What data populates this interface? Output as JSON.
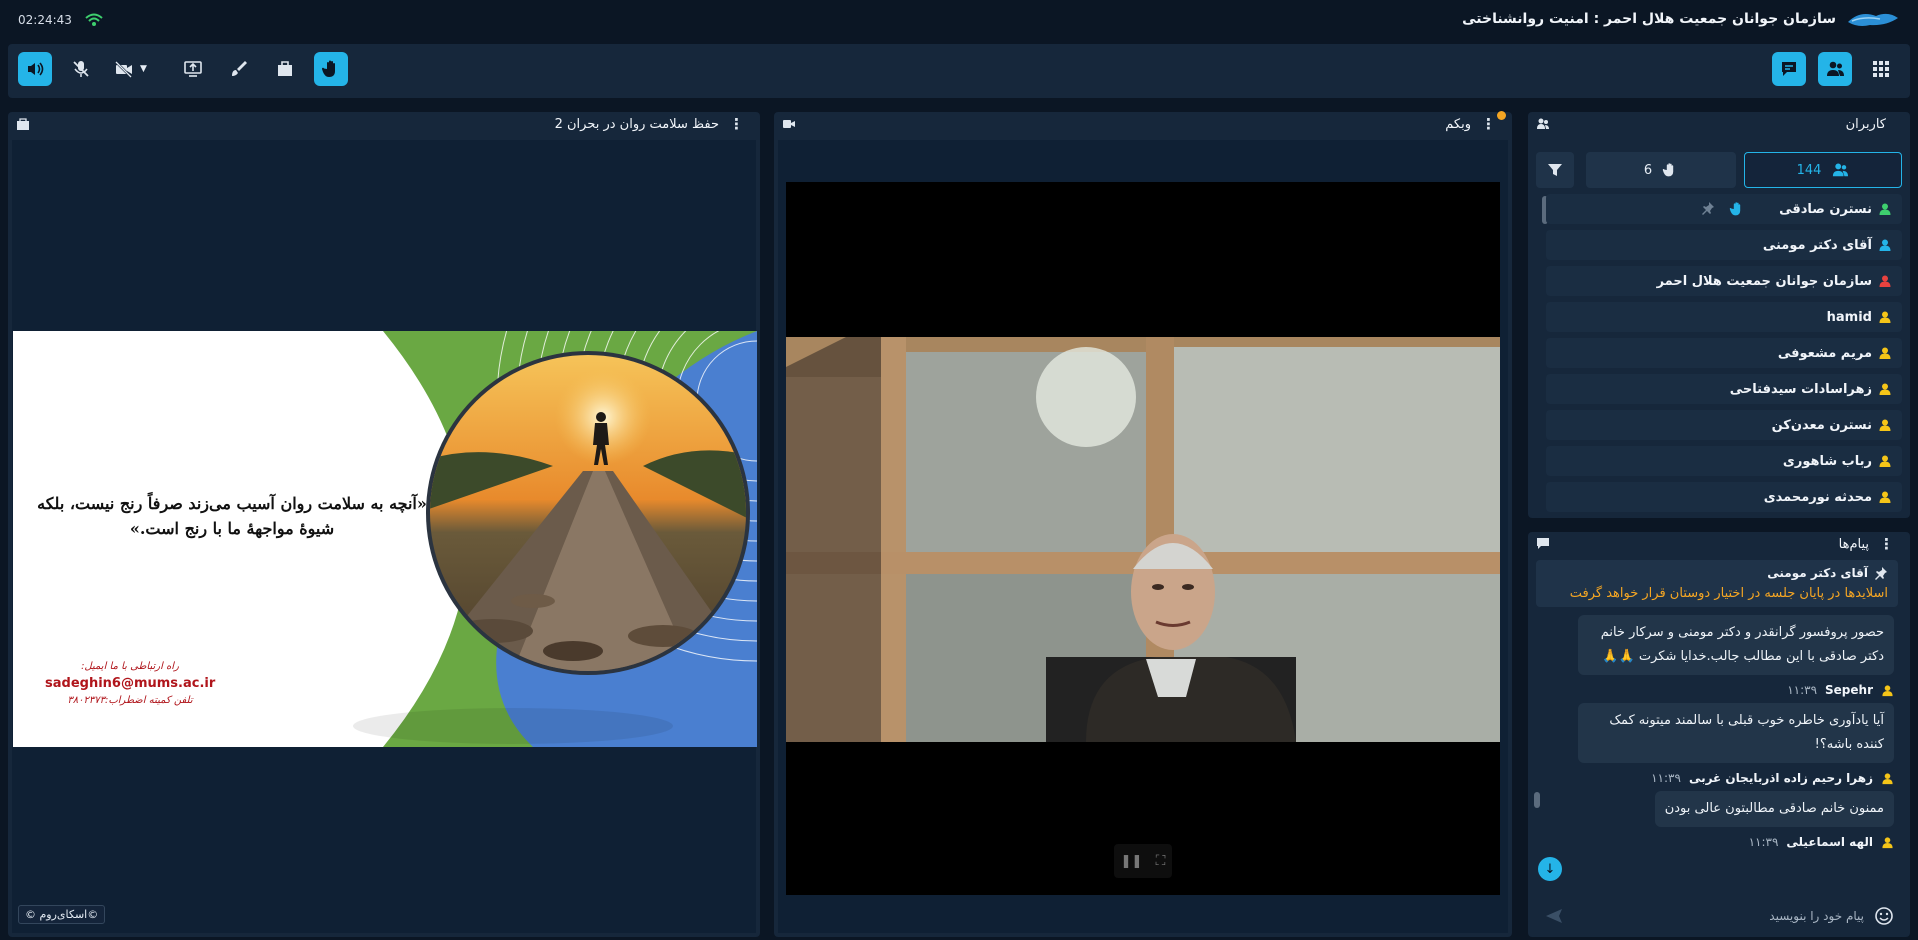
{
  "app": {
    "title": "سازمان جوانان جمعیت هلال احمر : امنیت روانشناختی",
    "clock": "02:24:43"
  },
  "toolbar": {
    "left_buttons": [
      "speaker-icon",
      "mic-muted-icon",
      "camera-off-icon",
      "screen-share-icon",
      "brush-icon",
      "file-icon",
      "raise-hand-icon"
    ],
    "right_buttons": [
      "chat-icon",
      "users-icon",
      "apps-grid-icon"
    ]
  },
  "colors": {
    "accent": "#24b4e8",
    "panel": "#16273b",
    "bg": "#0b1624",
    "pinned_text": "#f5a623"
  },
  "presentation": {
    "title": "حفظ سلامت روان در بحران 2",
    "quote": "«آنچه به سلامت روان آسیب می‌زند صرفاً رنج نیست، بلکه شیوهٔ مواجههٔ ما با رنج است.»",
    "contact_line1": "راه ارتباطی با ما ایمیل:",
    "contact_email": "sadeghin6@mums.ac.ir",
    "contact_line3": "تلفن کمیته اضطراب:۳۸۰۲۳۷۳",
    "watermark": "©اسکای‌روم ©"
  },
  "webcam": {
    "title": "وبکم"
  },
  "users": {
    "title": "کاربران",
    "tab_all_count": "144",
    "tab_hands_count": "6",
    "list": [
      {
        "name": "نسترن صادقی",
        "color": "#3ecf6e"
      },
      {
        "name": "آقای دکتر مومنی",
        "color": "#24b4e8"
      },
      {
        "name": "سازمان جوانان جمعیت هلال احمر",
        "color": "#e8423f"
      },
      {
        "name": "hamid",
        "color": "#f5c518"
      },
      {
        "name": "مریم مشعوفی",
        "color": "#f5c518"
      },
      {
        "name": "زهراسادات سیدفتاحی",
        "color": "#f5c518"
      },
      {
        "name": "نسترن معدن‌کن",
        "color": "#f5c518"
      },
      {
        "name": "رباب شاهوری",
        "color": "#f5c518"
      },
      {
        "name": "محدثه نورمحمدی",
        "color": "#f5c518"
      }
    ]
  },
  "chat": {
    "title": "پیام‌ها",
    "pinned_name": "آقای دکتر مومنی",
    "pinned_message": "اسلایدها در پایان جلسه در اختیار دوستان قرار خواهد گرفت",
    "first_bubble": "حصور پروفسور گرانقدر و دکتر مومنی و سرکار خانم دکتر صادقی با این مطالب جالب.خدایا شکرت 🙏🙏",
    "messages": [
      {
        "name": "Sepehr",
        "time": "۱۱:۳۹",
        "text": "آیا یادآوری خاطره خوب قبلی با سالمند میتونه کمک کننده باشه؟!"
      },
      {
        "name": "زهرا رحیم زاده اذربایجان غربی",
        "time": "۱۱:۳۹",
        "text": "ممنون خانم صادقی مطالبتون عالی بودن"
      },
      {
        "name": "الهه اسماعیلی",
        "time": "۱۱:۳۹",
        "text": ""
      }
    ],
    "input_placeholder": "پیام خود را بنویسید"
  }
}
